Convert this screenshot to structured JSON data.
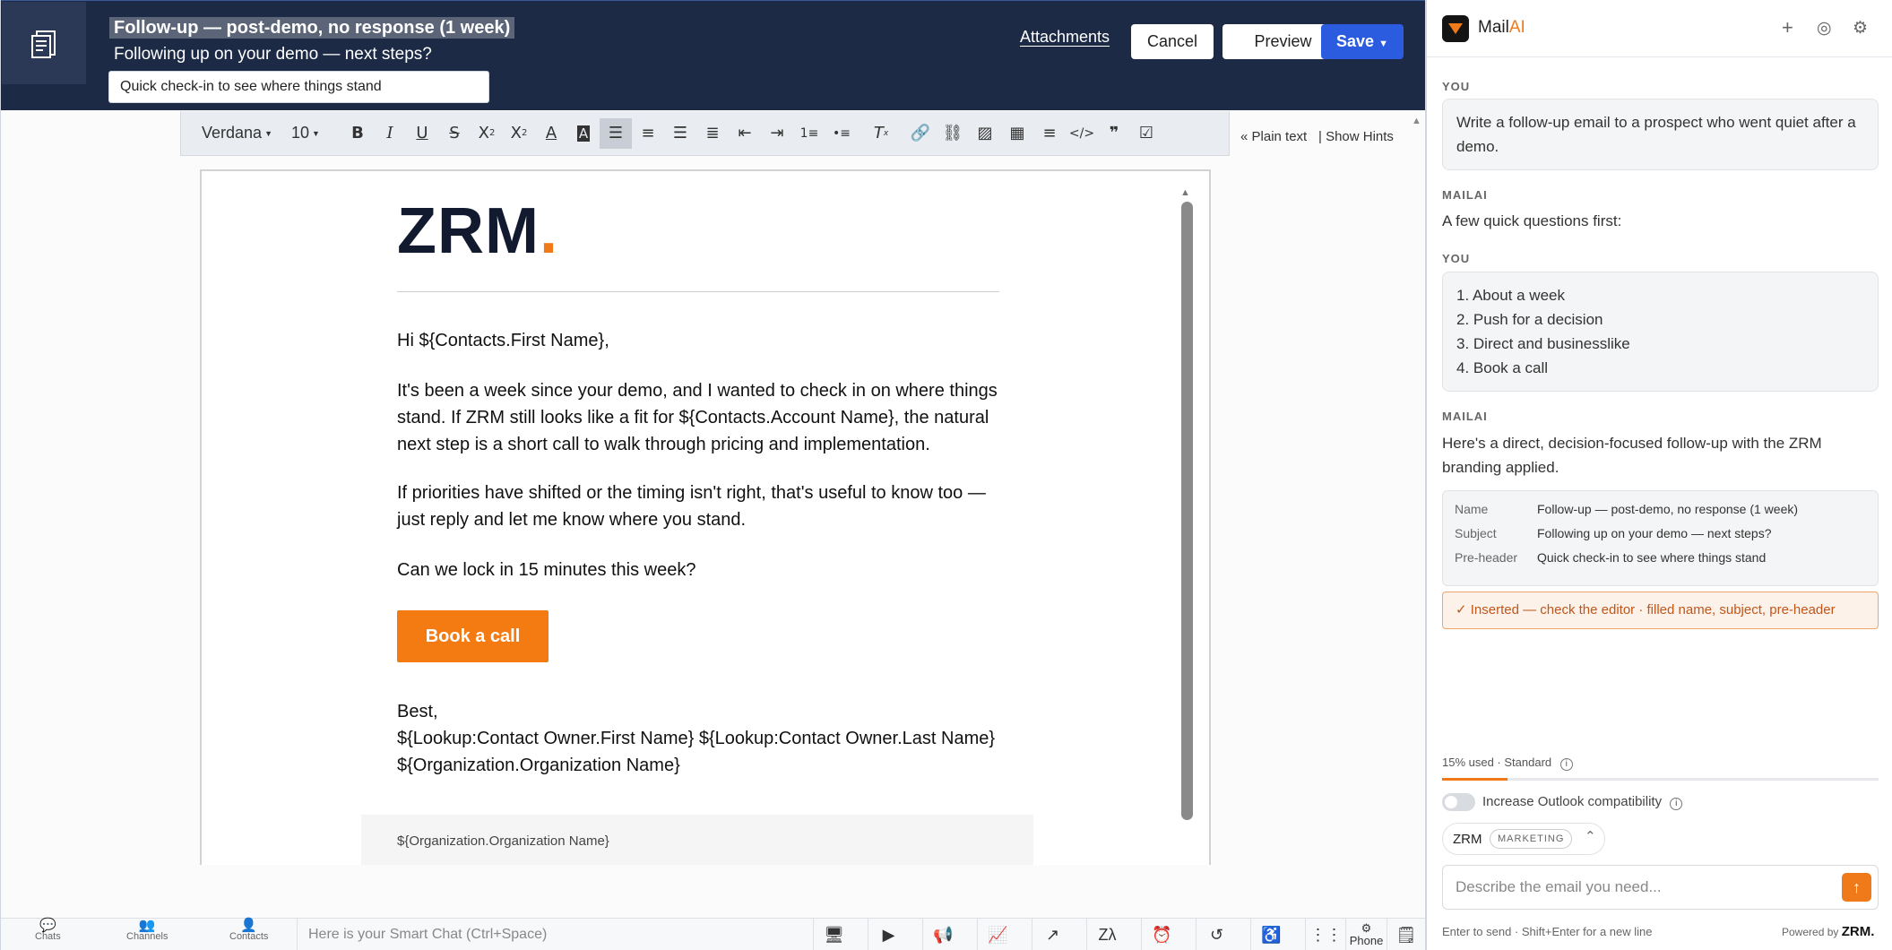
{
  "header": {
    "template_name": "Follow-up — post-demo, no response (1 week)",
    "subject": "Following up on your demo — next steps?",
    "preheader": "Quick check-in to see where things stand",
    "attachments_label": "Attachments",
    "cancel_label": "Cancel",
    "preview_label": "Preview",
    "save_label": "Save"
  },
  "toolbar": {
    "font": "Verdana",
    "size": "10",
    "plain_text": "« Plain text",
    "show_hints": "| Show Hints",
    "icons": [
      "bold-icon",
      "italic-icon",
      "underline-icon",
      "strikethrough-icon",
      "subscript-icon",
      "superscript-icon",
      "font-color-icon",
      "highlight-icon",
      "align-left-icon",
      "align-center-icon",
      "align-right-icon",
      "justify-icon",
      "outdent-icon",
      "indent-icon",
      "numbered-list-icon",
      "bullet-list-icon",
      "clear-format-icon",
      "link-icon",
      "unlink-icon",
      "image-icon",
      "table-icon",
      "horizontal-rule-icon",
      "code-icon",
      "quote-icon",
      "checklist-icon"
    ]
  },
  "email": {
    "logo_text": "ZRM",
    "logo_dot": ".",
    "greeting": "Hi ${Contacts.First Name},",
    "para1": "It's been a week since your demo, and I wanted to check in on where things stand. If ZRM still looks like a fit for ${Contacts.Account Name}, the natural next step is a short call to walk through pricing and implementation.",
    "para2": "If priorities have shifted or the timing isn't right, that's useful to know too — just reply and let me know where you stand.",
    "para3": "Can we lock in 15 minutes this week?",
    "cta": "Book a call",
    "signoff": "Best,",
    "signature_name": "${Lookup:Contact Owner.First Name} ${Lookup:Contact Owner.Last Name}",
    "signature_org": "${Organization.Organization Name}",
    "footer_org": "${Organization.Organization Name}"
  },
  "bottombar": {
    "nav": [
      "Chats",
      "Channels",
      "Contacts"
    ],
    "smartchat_placeholder": "Here is your Smart Chat (Ctrl+Space)",
    "phone_label": "Phone"
  },
  "panel": {
    "title_main": "Mail",
    "title_accent": "AI",
    "you_label": "YOU",
    "mailai_label": "MAILAI",
    "msg1": "Write a follow-up email to a prospect who went quiet after a demo.",
    "msg2": "A few quick questions first:",
    "answers": [
      "1. About a week",
      "2. Push for a decision",
      "3. Direct and businesslike",
      "4. Book a call"
    ],
    "msg3": "Here's a direct, decision-focused follow-up with the ZRM branding applied.",
    "card": [
      {
        "k": "Name",
        "v": "Follow-up — post-demo, no response (1 week)"
      },
      {
        "k": "Subject",
        "v": "Following up on your demo — next steps?"
      },
      {
        "k": "Pre-header",
        "v": "Quick check-in to see where things stand"
      }
    ],
    "inserted": "✓  Inserted — check the editor · filled name, subject, pre-header",
    "usage_text": "15% used · Standard",
    "usage_fraction": 0.15,
    "outlook_label": "Increase Outlook compatibility",
    "brand_name": "ZRM",
    "brand_tag": "MARKETING",
    "composer_placeholder": "Describe the email you need...",
    "send_hint": "Enter to send · Shift+Enter for a new line",
    "powered_by": "Powered by",
    "powered_brand": "ZRM."
  },
  "colors": {
    "accent": "#f07a1a",
    "navy": "#1d2a45",
    "save_blue": "#2b5ce0"
  }
}
